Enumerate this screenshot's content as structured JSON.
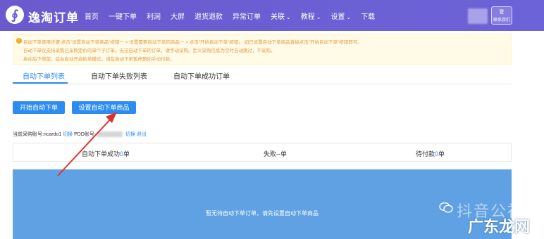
{
  "app": {
    "logo_glyph": "∮",
    "title": "逸淘订单"
  },
  "nav": [
    {
      "label": "首页",
      "dropdown": false
    },
    {
      "label": "一键下单",
      "dropdown": false
    },
    {
      "label": "利润",
      "dropdown": false
    },
    {
      "label": "大屏",
      "dropdown": false
    },
    {
      "label": "退货退款",
      "dropdown": false
    },
    {
      "label": "异常订单",
      "dropdown": false
    },
    {
      "label": "关联",
      "dropdown": true
    },
    {
      "label": "教程",
      "dropdown": true
    },
    {
      "label": "设置",
      "dropdown": true
    },
    {
      "label": "下载",
      "dropdown": false
    }
  ],
  "user": {
    "line1": "登",
    "line2": "联系我们"
  },
  "notice": {
    "icon": "warning-icon",
    "lines": [
      "自动下单使用步骤:点击\"设置自动下单商品\"按钮一 > 设置需要自动下单的商品一 > 点击\"开始自动下单\"按钮。  如已设置自动下单商品直接点击\"开始自动下单\"按钮即可。",
      "自动下单仅支持采购已采购定价的单个子订单。无法自动下单的订单，请手动采购。定义采购信息为空时自动跳过，不采购。",
      "启动后下单前，后台自动开启检单模式。请在自动下单暂停期间手动付款。"
    ]
  },
  "tabs": [
    {
      "label": "自动下单列表",
      "active": true
    },
    {
      "label": "自动下单失败列表",
      "active": false
    },
    {
      "label": "自动下单成功订单",
      "active": false
    }
  ],
  "buttons": {
    "start": "开始自动下单",
    "set_products": "设置自动下单商品"
  },
  "account": {
    "purchase_label": "当前采购账号:ricardo1",
    "switch1": "切换",
    "pdd_label": "PDD账号:",
    "switch2": "切换",
    "logout": "退出"
  },
  "stats": {
    "success_label": "自动下单成功",
    "success_value": "0",
    "success_unit": "单",
    "fail_text": "失败--单",
    "pending_label": "待付款",
    "pending_value": "0",
    "pending_unit": "单"
  },
  "empty_message": "暂无待自动下单订单，请先设置自动下单商品",
  "watermark": {
    "line1": "抖音公社",
    "line2": "广东龙网",
    "icon": "wechat-icon"
  },
  "colors": {
    "topbar": "#6a5acd",
    "accent": "#2d8cf0",
    "notice_bg": "#fffbe6",
    "empty_bg": "#5fa1e3",
    "arrow": "#e0302a"
  }
}
